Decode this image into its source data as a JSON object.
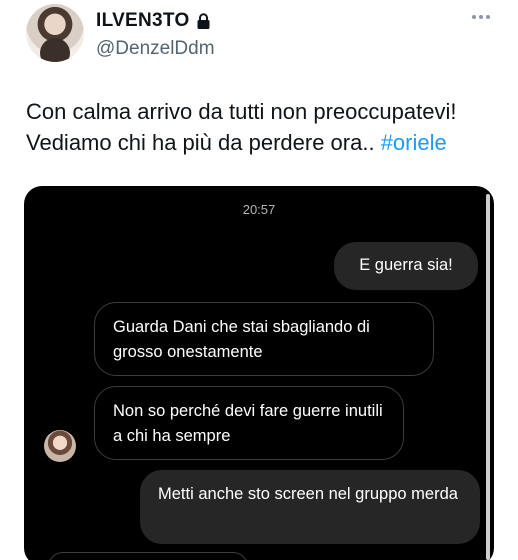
{
  "tweet": {
    "display_name": "ILVEN3TO",
    "handle": "@DenzelDdm",
    "text_line1": "Con calma arrivo da tutti non preoccupatevi!",
    "text_line2": "Vediamo chi ha più da perdere ora.. ",
    "hashtag": "#oriele",
    "lock_icon": "lock-icon",
    "more_icon": "more-horizontal-icon",
    "accent_color": "#1d9bf0"
  },
  "chat": {
    "time": "20:57",
    "messages": [
      {
        "direction": "sent",
        "text": "E guerra sia!"
      },
      {
        "direction": "received",
        "text": "Guarda Dani che stai sbagliando di grosso onestamente"
      },
      {
        "direction": "received",
        "text": "Non so perché devi fare guerre inutili a chi ha sempre"
      },
      {
        "direction": "sent",
        "text": "Metti anche sto screen nel gruppo merda"
      }
    ]
  }
}
